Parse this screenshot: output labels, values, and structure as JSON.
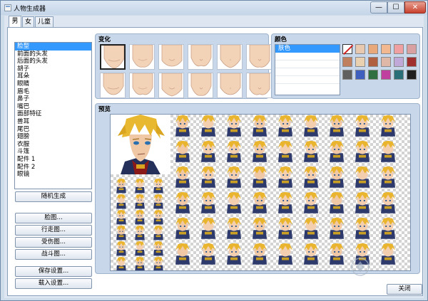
{
  "window": {
    "title": "人物生成器",
    "min_glyph": "—",
    "max_glyph": "☐",
    "close_glyph": "✕"
  },
  "tabs": [
    {
      "label": "男",
      "active": true
    },
    {
      "label": "女"
    },
    {
      "label": "儿童"
    }
  ],
  "parts": [
    "脸型",
    "前面的头发",
    "后面的头发",
    "胡子",
    "耳朵",
    "眼睛",
    "眉毛",
    "鼻子",
    "嘴巴",
    "面部特征",
    "兽耳",
    "尾巴",
    "翅膀",
    "衣服",
    "斗篷",
    "配件 1",
    "配件 2",
    "眼镜"
  ],
  "selected_part": "脸型",
  "buttons": {
    "random": "随机生成",
    "face": "脸图...",
    "walk": "行走图...",
    "damage": "受伤图...",
    "battle": "战斗图...",
    "save": "保存设置...",
    "load": "载入设置...",
    "close": "关闭"
  },
  "variation": {
    "title": "变化",
    "selected_index": 0
  },
  "color": {
    "title": "颜色",
    "items": [
      "肤色"
    ],
    "swatches": [
      "none",
      "#e8c8ae",
      "#e8a87a",
      "#f2b990",
      "#f0a0a0",
      "#d8a0a0",
      "#c08060",
      "#e8d0b0",
      "#b06040",
      "#e0b8a8",
      "#c0a8d8",
      "#a03030",
      "#606060",
      "#4060c0",
      "#307040",
      "#c040a0",
      "#2a6e78",
      "#202020"
    ]
  },
  "preview": {
    "title": "预览"
  },
  "watermark": {
    "line1": "当下软件园",
    "line2": "www.downxia.com"
  }
}
